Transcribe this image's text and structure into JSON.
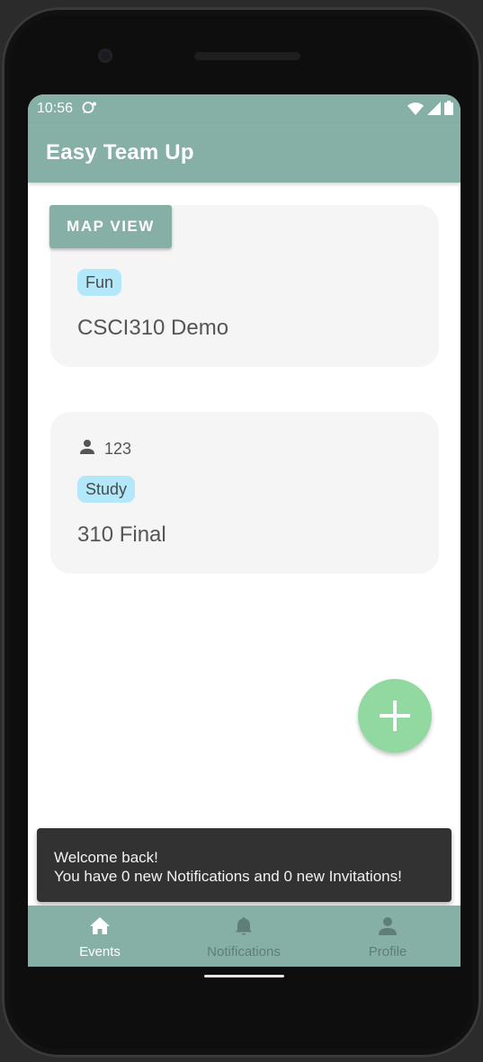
{
  "status_bar": {
    "time": "10:56",
    "icons": [
      "notification-bubble-icon",
      "wifi-icon",
      "signal-icon",
      "battery-icon"
    ]
  },
  "app_bar": {
    "title": "Easy Team Up"
  },
  "map_view_button": {
    "label": "MAP VIEW"
  },
  "events": [
    {
      "tag": "Fun",
      "title": "CSCI310 Demo"
    },
    {
      "members": "123",
      "tag": "Study",
      "title": "310 Final"
    }
  ],
  "fab": {
    "icon": "plus-icon"
  },
  "snackbar": {
    "line1": "Welcome back!",
    "line2": "You have 0 new Notifications and 0 new Invitations!"
  },
  "bottom_nav": {
    "items": [
      {
        "label": "Events",
        "icon": "home-icon",
        "active": true
      },
      {
        "label": "Notifications",
        "icon": "bell-icon",
        "active": false
      },
      {
        "label": "Profile",
        "icon": "person-icon",
        "active": false
      }
    ]
  },
  "colors": {
    "primary": "#86afa5",
    "chip": "#b3e8fb",
    "fab": "#91d9a0",
    "card": "#f5f5f5",
    "snackbar": "#323232"
  }
}
